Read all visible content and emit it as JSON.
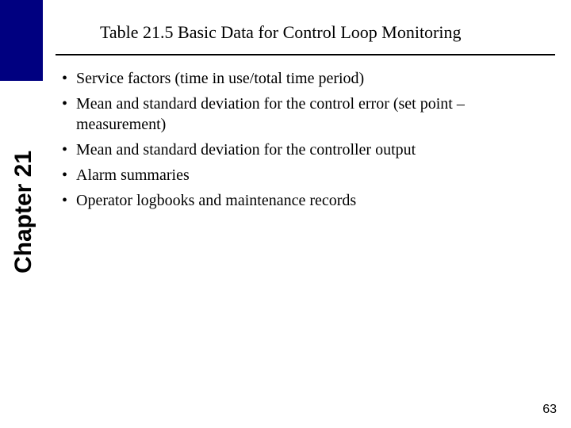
{
  "chapter_label": "Chapter 21",
  "title": "Table 21.5 Basic Data for Control Loop Monitoring",
  "bullets": {
    "b0": "Service factors (time in use/total time period)",
    "b1": "Mean and standard deviation for the control error (set point – measurement)",
    "b2": "Mean and standard deviation for the controller output",
    "b3": "Alarm summaries",
    "b4": "Operator logbooks and maintenance records"
  },
  "page_number": "63"
}
